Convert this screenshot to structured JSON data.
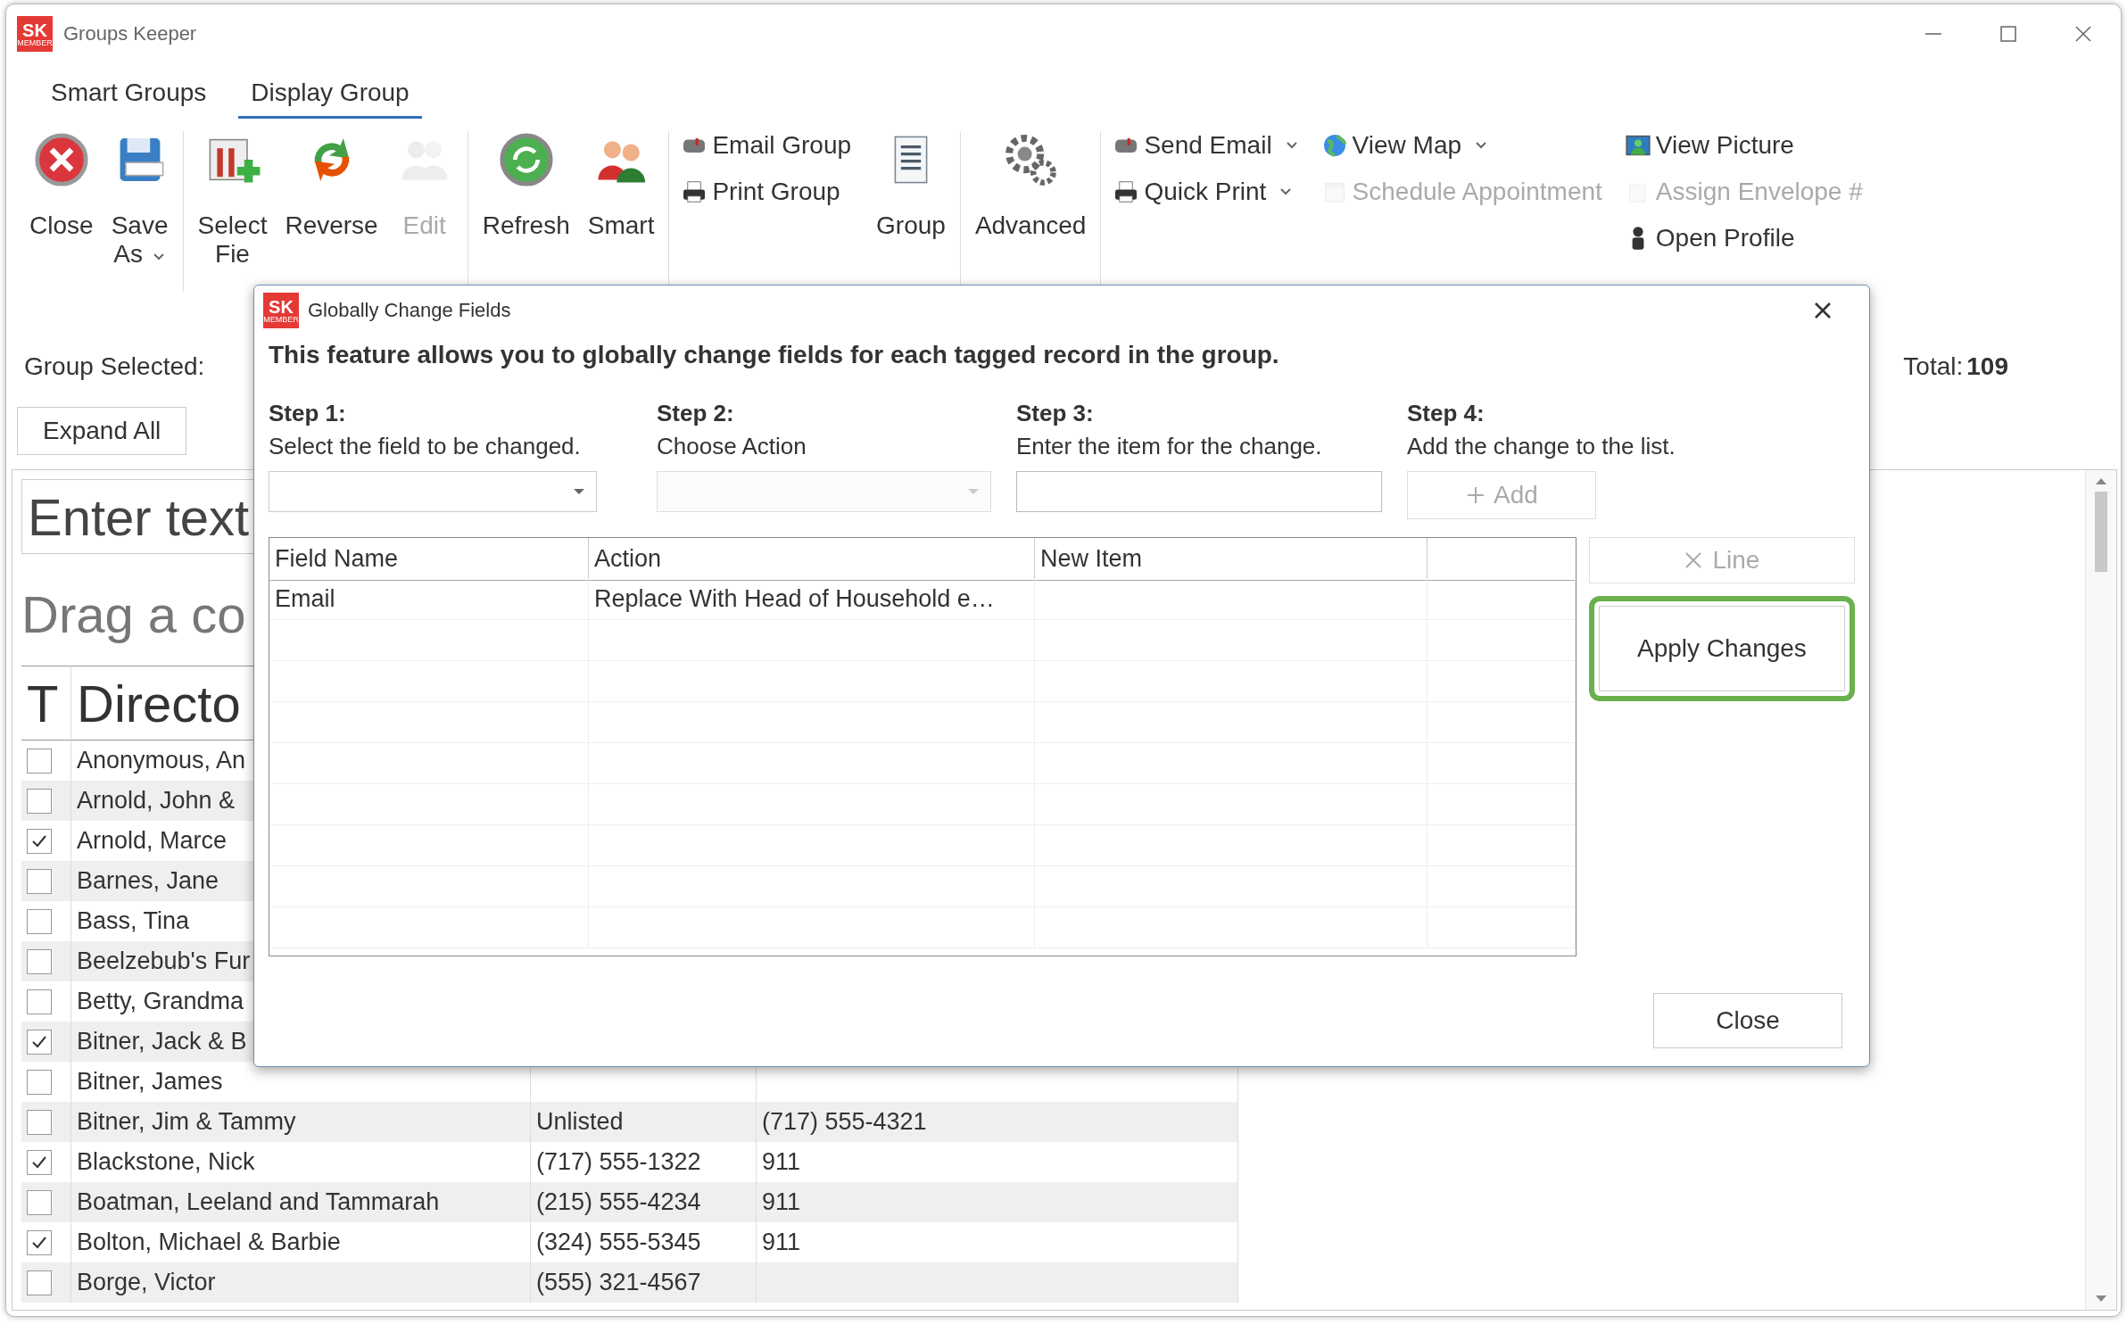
{
  "window": {
    "title": "Groups Keeper",
    "logo": "SK",
    "logo_caption": "MEMBER"
  },
  "tabs": [
    {
      "label": "Smart Groups",
      "selected": false
    },
    {
      "label": "Display Group",
      "selected": true
    }
  ],
  "ribbon": {
    "sections": [
      {
        "kind": "large",
        "buttons": [
          {
            "label": "Close",
            "disabled": false,
            "dropdown": false
          },
          {
            "label": "Save As",
            "disabled": false,
            "dropdown": true
          }
        ]
      },
      {
        "kind": "large",
        "buttons": [
          {
            "label": "Select Fie",
            "disabled": false,
            "dropdown": false
          },
          {
            "label": "Reverse",
            "disabled": false,
            "dropdown": false
          },
          {
            "label": "Edit",
            "disabled": true,
            "dropdown": false
          }
        ]
      },
      {
        "kind": "large",
        "buttons": [
          {
            "label": "Refresh",
            "disabled": false,
            "dropdown": false
          },
          {
            "label": "Smart",
            "disabled": false,
            "dropdown": false
          }
        ]
      },
      {
        "kind": "small",
        "buttons": [
          {
            "label": "Email Group",
            "disabled": false,
            "dropdown": false
          },
          {
            "label": "Print Group",
            "disabled": false,
            "dropdown": false
          }
        ]
      },
      {
        "kind": "large",
        "buttons": [
          {
            "label": "Group",
            "disabled": false,
            "dropdown": false
          }
        ]
      },
      {
        "kind": "large",
        "buttons": [
          {
            "label": "Advanced",
            "disabled": false,
            "dropdown": false
          }
        ]
      },
      {
        "kind": "small",
        "buttons": [
          {
            "label": "Send Email",
            "disabled": false,
            "dropdown": true
          },
          {
            "label": "Quick Print",
            "disabled": false,
            "dropdown": true
          }
        ]
      },
      {
        "kind": "small",
        "buttons": [
          {
            "label": "View Map",
            "disabled": false,
            "dropdown": true
          },
          {
            "label": "Schedule Appointment",
            "disabled": true,
            "dropdown": false
          }
        ]
      },
      {
        "kind": "small",
        "buttons": [
          {
            "label": "View Picture",
            "disabled": false,
            "dropdown": false
          },
          {
            "label": "Assign Envelope #",
            "disabled": true,
            "dropdown": false
          },
          {
            "label": "Open Profile",
            "disabled": false,
            "dropdown": false
          }
        ]
      }
    ]
  },
  "group_bar": {
    "label": "Group Selected:",
    "total_label": "Total:",
    "total": "109"
  },
  "toolbar": {
    "buttons": [
      "Expand All"
    ]
  },
  "grid": {
    "search_placeholder": "Enter text",
    "group_hint": "Drag a co",
    "columns": [
      "T",
      "Directo"
    ],
    "rows": [
      {
        "name": "Anonymous, An",
        "checked": false
      },
      {
        "name": "Arnold, John &",
        "checked": false
      },
      {
        "name": "Arnold, Marce",
        "checked": true
      },
      {
        "name": "Barnes, Jane",
        "checked": false
      },
      {
        "name": "Bass, Tina",
        "checked": false
      },
      {
        "name": "Beelzebub's Fur",
        "checked": false
      },
      {
        "name": "Betty, Grandma",
        "checked": false
      },
      {
        "name": "Bitner, Jack & B",
        "checked": true
      },
      {
        "name": "Bitner, James",
        "checked": false
      },
      {
        "name": "Bitner, Jim & Tammy",
        "checked": false,
        "column_2": "Unlisted",
        "column_3": "(717) 555-4321"
      },
      {
        "name": "Blackstone, Nick",
        "checked": true,
        "column_2": "(717) 555-1322",
        "column_3": "911"
      },
      {
        "name": "Boatman, Leeland and Tammarah",
        "checked": false,
        "column_2": "(215) 555-4234",
        "column_3": "911"
      },
      {
        "name": "Bolton, Michael & Barbie",
        "checked": true,
        "column_2": "(324) 555-5345",
        "column_3": "911"
      },
      {
        "name": "Borge, Victor",
        "checked": false,
        "column_2": "(555) 321-4567"
      }
    ]
  },
  "dialog": {
    "title": "Globally Change Fields",
    "logo": "SK",
    "logo_caption": "MEMBER",
    "heading": "This feature allows you to globally change fields for each tagged record in the group.",
    "steps": [
      {
        "title": "Step 1:",
        "text": "Select the field to be changed.",
        "kind": "dropdown",
        "disabled": false
      },
      {
        "title": "Step 2:",
        "text": "Choose Action",
        "kind": "dropdown",
        "disabled": true
      },
      {
        "title": "Step 3:",
        "text": "Enter the item for the change.",
        "kind": "text",
        "disabled": false
      },
      {
        "title": "Step 4:",
        "text": "Add the change to the list.",
        "kind": "button",
        "label": "Add",
        "disabled": true
      }
    ],
    "table": {
      "columns": [
        "Field Name",
        "Action",
        "New Item"
      ],
      "rows": [
        {
          "field_name": "Email",
          "action": "Replace With Head of Household e…"
        }
      ]
    },
    "line_button": {
      "label": "Line",
      "disabled": true
    },
    "apply_button": {
      "label": "Apply Changes",
      "highlighted": true
    },
    "close_button": {
      "label": "Close"
    }
  }
}
